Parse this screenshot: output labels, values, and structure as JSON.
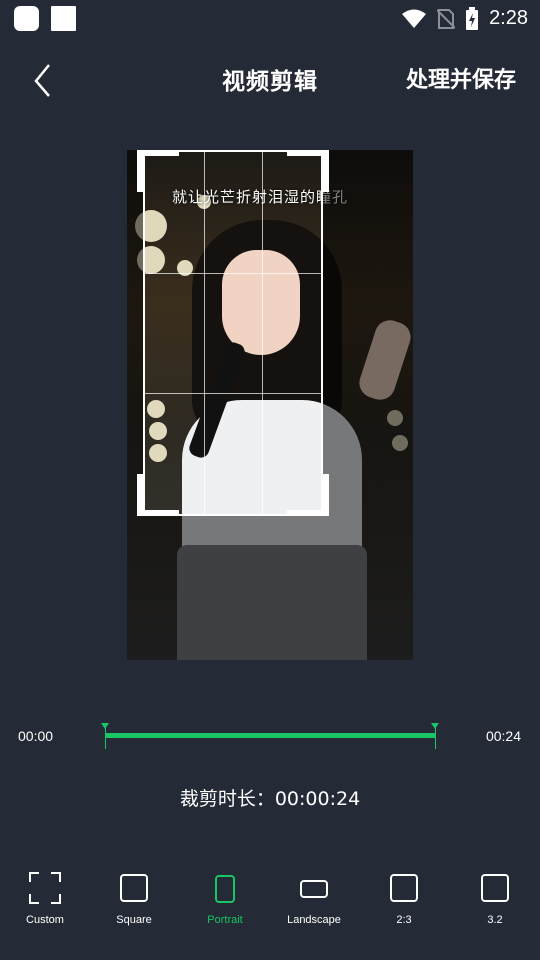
{
  "status_bar": {
    "time": "2:28"
  },
  "header": {
    "title": "视频剪辑",
    "save_label": "处理并保存"
  },
  "video": {
    "caption": "就让光芒折射泪湿的瞳孔"
  },
  "timeline": {
    "start": "00:00",
    "end": "00:24"
  },
  "duration_label": "裁剪时长：00:00:24",
  "ratios": [
    {
      "label": "Custom",
      "icon": "custom-crop-icon"
    },
    {
      "label": "Square",
      "icon": "square-icon"
    },
    {
      "label": "Portrait",
      "icon": "portrait-icon",
      "active": true
    },
    {
      "label": "Landscape",
      "icon": "landscape-icon"
    },
    {
      "label": "2:3",
      "icon": "ratio-2-3-icon"
    },
    {
      "label": "3.2",
      "icon": "ratio-3-2-icon"
    }
  ],
  "colors": {
    "background": "#252a37",
    "accent": "#19c564",
    "text": "#ffffff"
  }
}
